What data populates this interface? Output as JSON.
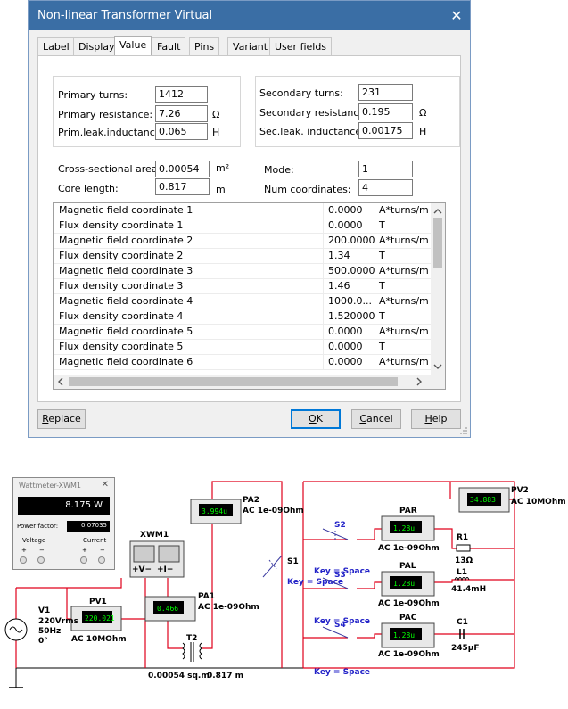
{
  "dialog": {
    "title": "Non-linear Transformer Virtual",
    "close_glyph": "✕",
    "tabs": [
      "Label",
      "Display",
      "Value",
      "Fault",
      "Pins",
      "Variant",
      "User fields"
    ],
    "active_tab": "Value",
    "primary": {
      "turns_label": "Primary turns:",
      "turns": "1412",
      "resistance_label": "Primary resistance:",
      "resistance": "7.26",
      "resistance_unit": "Ω",
      "leak_label": "Prim.leak.inductance:",
      "leak": "0.065",
      "leak_unit": "H"
    },
    "secondary": {
      "turns_label": "Secondary turns:",
      "turns": "231",
      "resistance_label": "Secondary resistance:",
      "resistance": "0.195",
      "resistance_unit": "Ω",
      "leak_label": "Sec.leak. inductance:",
      "leak": "0.00175",
      "leak_unit": "H"
    },
    "core": {
      "area_label": "Cross-sectional area:",
      "area": "0.00054",
      "area_unit": "m²",
      "length_label": "Core length:",
      "length": "0.817",
      "length_unit": "m",
      "mode_label": "Mode:",
      "mode": "1",
      "numcoord_label": "Num coordinates:",
      "numcoord": "4"
    },
    "grid_rows": [
      {
        "name": "Magnetic field coordinate 1",
        "value": "0.0000",
        "unit": "A*turns/m"
      },
      {
        "name": "Flux density coordinate 1",
        "value": "0.0000",
        "unit": "T"
      },
      {
        "name": "Magnetic field coordinate 2",
        "value": "200.0000",
        "unit": "A*turns/m"
      },
      {
        "name": "Flux density coordinate 2",
        "value": "1.34",
        "unit": "T"
      },
      {
        "name": "Magnetic field coordinate 3",
        "value": "500.0000",
        "unit": "A*turns/m"
      },
      {
        "name": "Flux density coordinate 3",
        "value": "1.46",
        "unit": "T"
      },
      {
        "name": "Magnetic field coordinate 4",
        "value": "1000.0...",
        "unit": "A*turns/m"
      },
      {
        "name": "Flux density coordinate 4",
        "value": "1.520000",
        "unit": "T"
      },
      {
        "name": "Magnetic field coordinate 5",
        "value": "0.0000",
        "unit": "A*turns/m"
      },
      {
        "name": "Flux density coordinate 5",
        "value": "0.0000",
        "unit": "T"
      },
      {
        "name": "Magnetic field coordinate 6",
        "value": "0.0000",
        "unit": "A*turns/m"
      }
    ],
    "buttons": {
      "replace": "Replace",
      "ok": "OK",
      "cancel": "Cancel",
      "help": "Help"
    }
  },
  "wattmeter": {
    "title": "Wattmeter-XWM1",
    "reading": "8.175 W",
    "pf_label": "Power factor:",
    "pf": "0.07035",
    "voltage_label": "Voltage",
    "current_label": "Current",
    "plus": "+",
    "minus": "−"
  },
  "circuit": {
    "xwm1": "XWM1",
    "xwm_plus_v": "+V−",
    "xwm_plus_i": "+I−",
    "v1": {
      "name": "V1",
      "l1": "220Vrms",
      "l2": "50Hz",
      "l3": "0°"
    },
    "pv1": {
      "name": "PV1",
      "reading": "220.021",
      "spec": "AC  10MOhm"
    },
    "pa1": {
      "name": "PA1",
      "reading": "0.466",
      "spec": "AC  1e-09Ohm"
    },
    "pa2": {
      "name": "PA2",
      "reading": "3.994u",
      "spec": "AC  1e-09Ohm"
    },
    "pv2": {
      "name": "PV2",
      "reading": "34.883",
      "spec": "AC  10MOhm"
    },
    "par": {
      "name": "PAR",
      "reading": "1.28u",
      "spec": "AC  1e-09Ohm"
    },
    "pal": {
      "name": "PAL",
      "reading": "1.28u",
      "spec": "AC  1e-09Ohm"
    },
    "pac": {
      "name": "PAC",
      "reading": "1.28u",
      "spec": "AC  1e-09Ohm"
    },
    "t2": {
      "name": "T2",
      "area": "0.00054 sq.m",
      "length": "0.817 m"
    },
    "s1": {
      "name": "S1",
      "key": "Key = Space"
    },
    "s2": {
      "name": "S2",
      "key": "Key = Space"
    },
    "s3": {
      "name": "S3",
      "key": "Key = Space"
    },
    "s4": {
      "name": "S4",
      "key": "Key = Space"
    },
    "r1": {
      "name": "R1",
      "value": "13Ω"
    },
    "l1": {
      "name": "L1",
      "value": "41.4mH"
    },
    "c1": {
      "name": "C1",
      "value": "245µF"
    }
  }
}
